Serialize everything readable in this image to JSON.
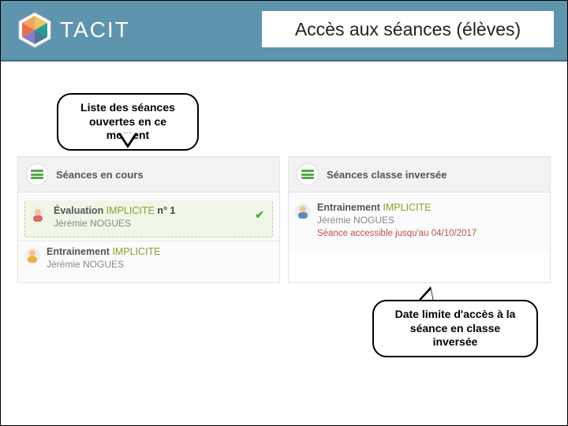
{
  "header": {
    "brand": "TACIT",
    "title": "Accès aux séances (élèves)"
  },
  "callouts": {
    "top": "Liste des séances\nouvertes en ce moment",
    "bottom": "Date limite d'accès à la\nséance en classe inversée"
  },
  "panels": {
    "left": {
      "title": "Séances en cours",
      "sessions": [
        {
          "type": "Évaluation",
          "module": "IMPLICITE",
          "num": "n° 1",
          "teacher": "Jérémie NOGUES",
          "checked": true,
          "highlight": true
        },
        {
          "type": "Entrainement",
          "module": "IMPLICITE",
          "num": "",
          "teacher": "Jérémie NOGUES",
          "checked": false,
          "highlight": false
        }
      ]
    },
    "right": {
      "title": "Séances classe inversée",
      "sessions": [
        {
          "type": "Entrainement",
          "module": "IMPLICITE",
          "num": "",
          "teacher": "Jérémie NOGUES",
          "limit": "Séance accessible jusqu'au 04/10/2017"
        }
      ]
    }
  }
}
